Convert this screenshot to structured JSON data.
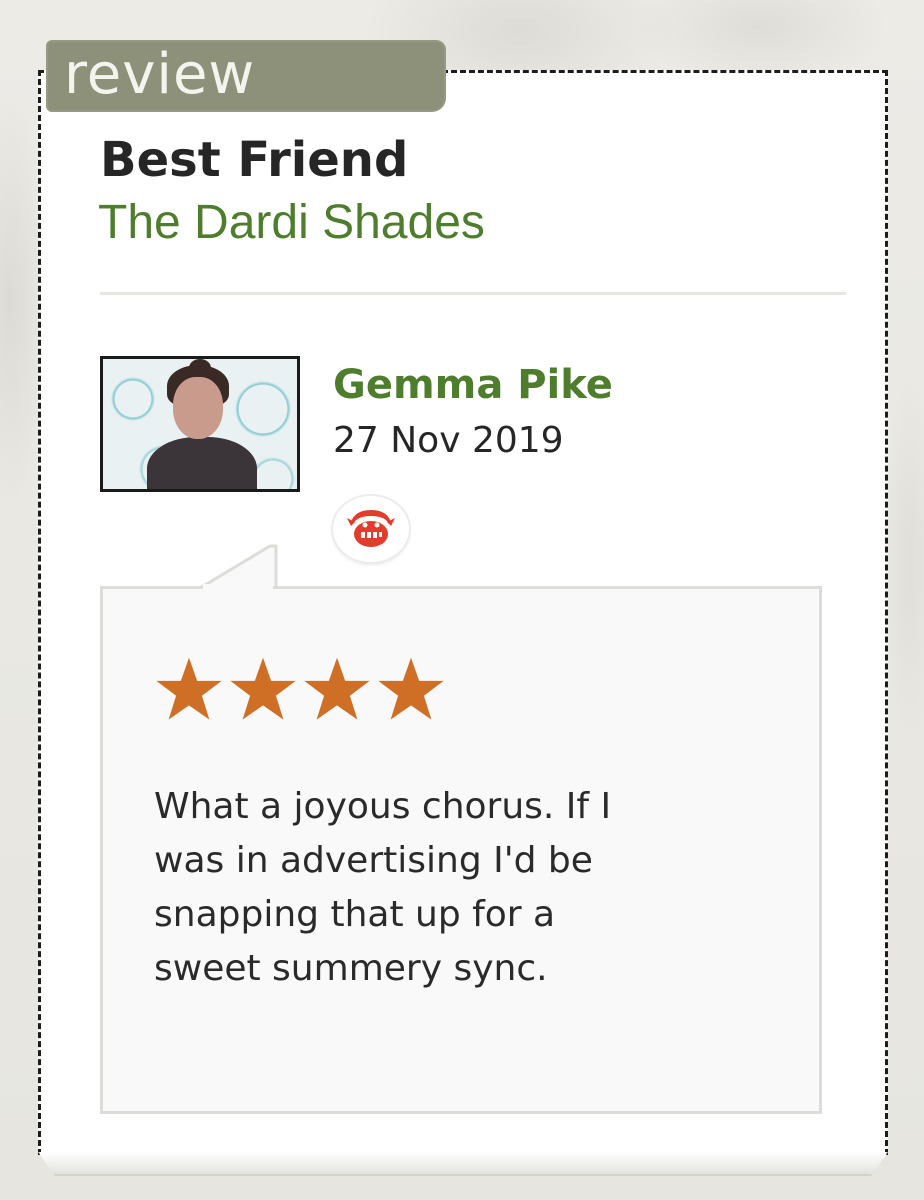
{
  "tab": {
    "label": "review"
  },
  "song": {
    "title": "Best Friend",
    "artist": "The Dardi Shades"
  },
  "reviewer": {
    "name": "Gemma Pike",
    "date": "27 Nov 2019",
    "avatar_icon": "reviewer-photo",
    "station_icon": "triple-j-logo"
  },
  "rating": {
    "stars": 4,
    "max": 4,
    "star_color": "#cf6f25"
  },
  "review": {
    "lines": [
      "What a joyous chorus. If I",
      "was in advertising I'd be",
      "snapping that up for a",
      "sweet summery sync."
    ]
  },
  "colors": {
    "accent_green": "#4f7d2e",
    "tab_bg": "#8e9179",
    "station_red": "#e43b2c"
  }
}
